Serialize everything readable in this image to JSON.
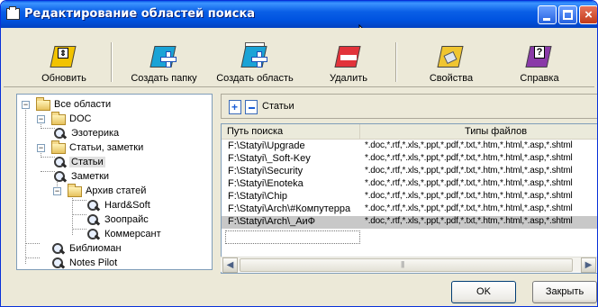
{
  "window": {
    "title": "Редактирование областей поиска"
  },
  "toolbar": {
    "refresh_label": "Обновить",
    "create_folder_label": "Создать папку",
    "create_area_label": "Создать область",
    "delete_label": "Удалить",
    "properties_label": "Свойства",
    "help_label": "Справка",
    "colors": {
      "refresh": "#f2c300",
      "create_folder": "#1aa3d6",
      "create_area": "#1aa3d6",
      "delete": "#e2333a",
      "properties": "#f0c530",
      "help": "#8a3aa8"
    }
  },
  "tree": {
    "items": [
      {
        "label": "Все области",
        "icon": "folder-icon"
      },
      {
        "label": "DOC",
        "icon": "folder-icon"
      },
      {
        "label": "Эзотерика",
        "icon": "magnifier-icon"
      },
      {
        "label": "Статьи, заметки",
        "icon": "folder-icon"
      },
      {
        "label": "Статьи",
        "icon": "magnifier-icon"
      },
      {
        "label": "Заметки",
        "icon": "magnifier-icon"
      },
      {
        "label": "Архив статей",
        "icon": "folder-icon"
      },
      {
        "label": "Hard&Soft",
        "icon": "magnifier-icon"
      },
      {
        "label": "Зоопрайс",
        "icon": "magnifier-icon"
      },
      {
        "label": "Коммерсант",
        "icon": "magnifier-icon"
      },
      {
        "label": "Библиоман",
        "icon": "magnifier-icon"
      },
      {
        "label": "Notes Pilot",
        "icon": "magnifier-icon"
      }
    ]
  },
  "detail": {
    "title": "Статьи",
    "columns": {
      "path": "Путь поиска",
      "types": "Типы файлов"
    },
    "rows": [
      {
        "path": "F:\\Statyi\\Upgrade",
        "types": "*.doc,*.rtf,*.xls,*.ppt,*.pdf,*.txt,*.htm,*.html,*.asp,*.shtml"
      },
      {
        "path": "F:\\Statyi\\_Soft-Key",
        "types": "*.doc,*.rtf,*.xls,*.ppt,*.pdf,*.txt,*.htm,*.html,*.asp,*.shtml"
      },
      {
        "path": "F:\\Statyi\\Security",
        "types": "*.doc,*.rtf,*.xls,*.ppt,*.pdf,*.txt,*.htm,*.html,*.asp,*.shtml"
      },
      {
        "path": "F:\\Statyi\\Enoteka",
        "types": "*.doc,*.rtf,*.xls,*.ppt,*.pdf,*.txt,*.htm,*.html,*.asp,*.shtml"
      },
      {
        "path": "F:\\Statyi\\Chip",
        "types": "*.doc,*.rtf,*.xls,*.ppt,*.pdf,*.txt,*.htm,*.html,*.asp,*.shtml"
      },
      {
        "path": "F:\\Statyi\\Arch\\#Компутерра",
        "types": "*.doc,*.rtf,*.xls,*.ppt,*.pdf,*.txt,*.htm,*.html,*.asp,*.shtml"
      },
      {
        "path": "F:\\Statyi\\Arch\\_АиФ",
        "types": "*.doc,*.rtf,*.xls,*.ppt,*.pdf,*.txt,*.htm,*.html,*.asp,*.shtml"
      }
    ],
    "new_row_value": ""
  },
  "buttons": {
    "ok": "OK",
    "close": "Закрыть"
  }
}
